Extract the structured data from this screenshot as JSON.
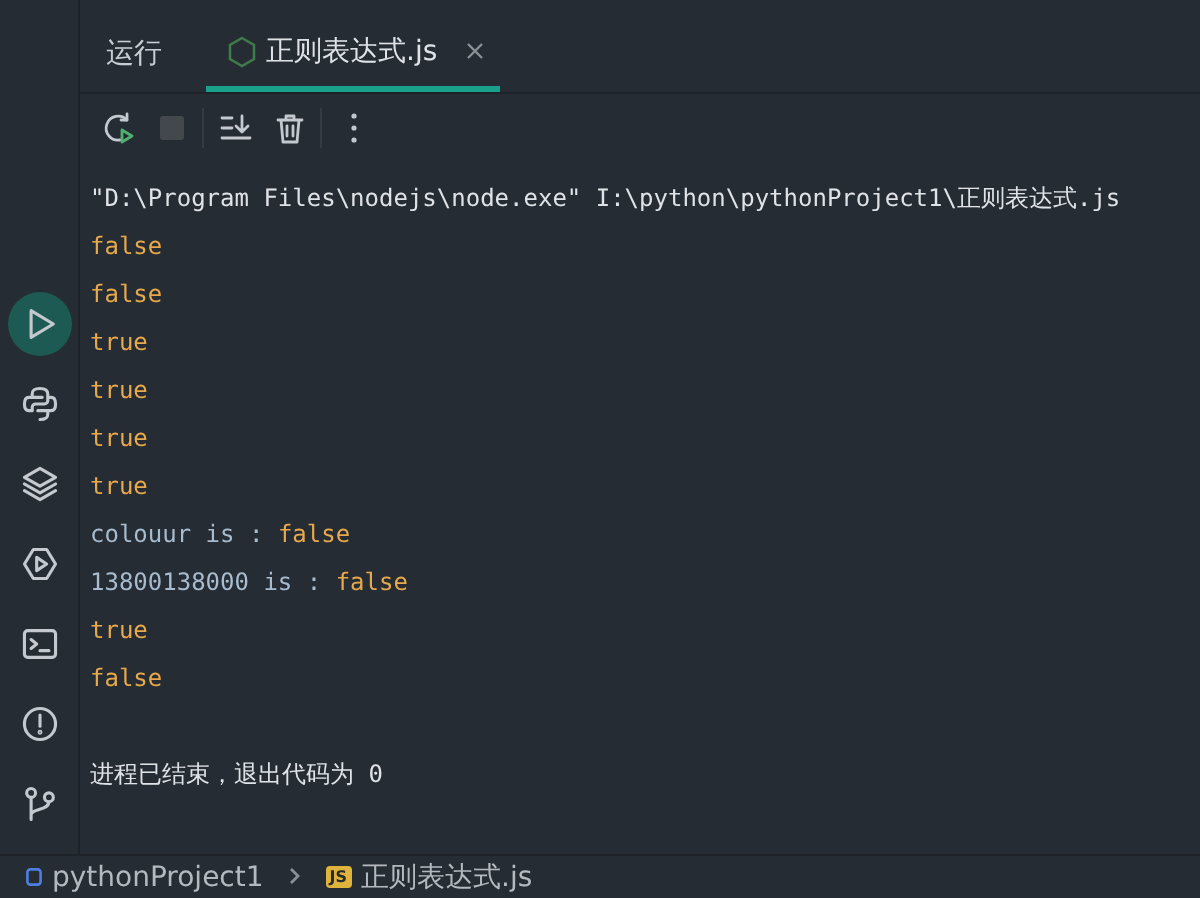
{
  "tool_window": {
    "title": "运行",
    "tabs": [
      {
        "label": "正则表达式.js",
        "selected": true
      }
    ]
  },
  "sidebar": {
    "items": [
      {
        "kind": "run",
        "selected": true
      },
      {
        "kind": "python",
        "selected": false
      },
      {
        "kind": "layers",
        "selected": false
      },
      {
        "kind": "services",
        "selected": false
      },
      {
        "kind": "terminal",
        "selected": false
      },
      {
        "kind": "problems",
        "selected": false
      },
      {
        "kind": "git",
        "selected": false
      }
    ]
  },
  "toolbar": {
    "items": [
      {
        "kind": "rerun"
      },
      {
        "kind": "stop",
        "disabled": true
      },
      {
        "kind": "scroll-end"
      },
      {
        "kind": "clear"
      },
      {
        "kind": "more"
      }
    ]
  },
  "console": {
    "lines": [
      {
        "kind": "plain",
        "text": "\"D:\\Program Files\\nodejs\\node.exe\" I:\\python\\pythonProject1\\正则表达式.js"
      },
      {
        "kind": "value",
        "text": "false"
      },
      {
        "kind": "value",
        "text": "false"
      },
      {
        "kind": "value",
        "text": "true"
      },
      {
        "kind": "value",
        "text": "true"
      },
      {
        "kind": "value",
        "text": "true"
      },
      {
        "kind": "value",
        "text": "true"
      },
      {
        "kind": "labeled",
        "label": "colouur is :",
        "text": "false"
      },
      {
        "kind": "labeled",
        "label": "13800138000 is :",
        "text": "false"
      },
      {
        "kind": "value",
        "text": "true"
      },
      {
        "kind": "value",
        "text": "false"
      },
      {
        "kind": "blank"
      },
      {
        "kind": "plain",
        "text": "进程已结束，退出代码为 0"
      }
    ]
  },
  "status_bar": {
    "breadcrumbs": [
      {
        "kind": "project",
        "label": "pythonProject1"
      },
      {
        "kind": "js",
        "badge": "JS",
        "label": "正则表达式.js"
      }
    ]
  }
}
